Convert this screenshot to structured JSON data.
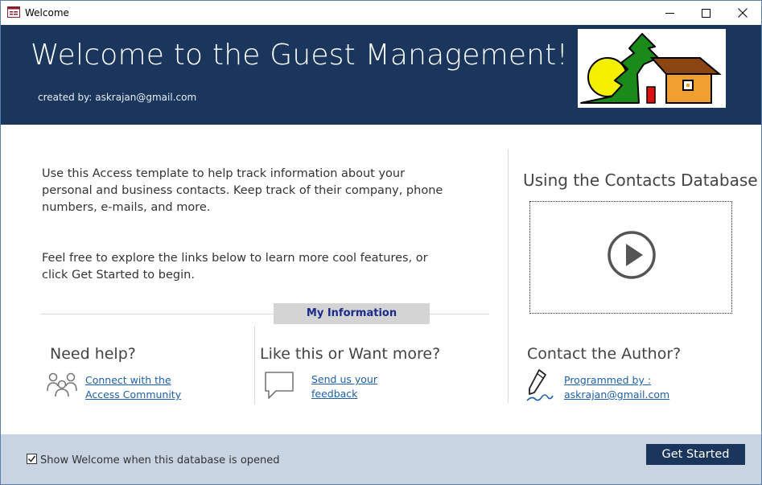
{
  "window": {
    "title": "Welcome",
    "icons": {
      "app": "form-icon",
      "minimize": "minimize-icon",
      "maximize": "maximize-icon",
      "close": "close-icon"
    }
  },
  "header": {
    "title": "Welcome to the Guest Management!",
    "created_by": "created by: askrajan@gmail.com",
    "logo": "house-sun-tree-logo"
  },
  "intro": {
    "paragraph1": "Use this Access template to help track information about your personal and business contacts. Keep track of their company, phone numbers, e-mails, and more.",
    "paragraph2": "Feel free to explore the links below to learn more cool features, or click Get Started to begin."
  },
  "my_information_label": "My Information",
  "video": {
    "title": "Using the Contacts Database",
    "icon": "play-icon"
  },
  "help": {
    "title": "Need help?",
    "link_line1": "Connect with the",
    "link_line2": "Access Community",
    "icon": "community-icon"
  },
  "more": {
    "title": "Like this or Want more?",
    "link_line1": "Send us your",
    "link_line2": "feedback",
    "icon": "speech-bubble-icon"
  },
  "author": {
    "title": "Contact the Author?",
    "link_line1": "Programmed by :",
    "link_line2": "askrajan@gmail.com",
    "icon": "pen-signature-icon"
  },
  "footer": {
    "checkbox_label": "Show Welcome when this database is opened",
    "checkbox_checked": true,
    "get_started": "Get Started"
  },
  "colors": {
    "header_bg": "#1b365d",
    "footer_bg": "#c8d4e2",
    "link": "#1f5fa8",
    "my_info_bg": "#d4d4d4",
    "my_info_text": "#1a2b8a"
  }
}
